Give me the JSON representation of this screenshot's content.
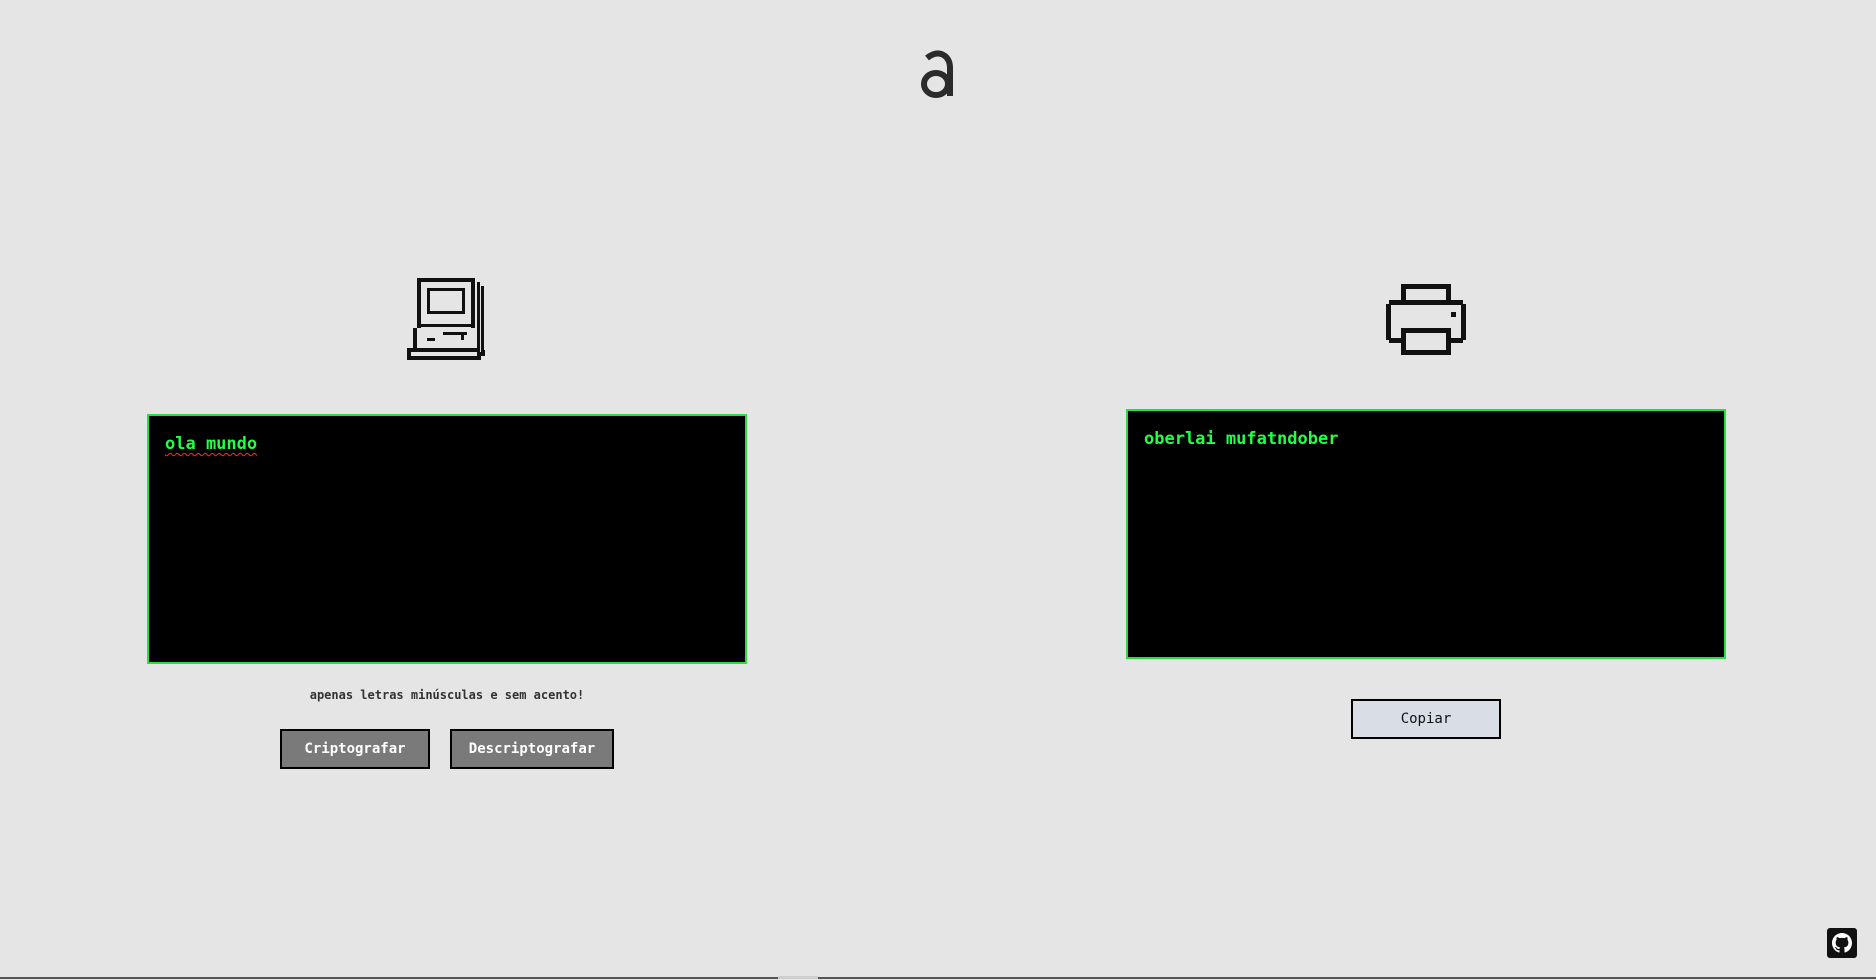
{
  "header": {
    "logo_icon": "alura-logo-icon"
  },
  "left_panel": {
    "icon": "computer-icon",
    "input_value": "ola mundo",
    "hint": "apenas letras minúsculas e sem acento!",
    "encrypt_label": "Criptografar",
    "decrypt_label": "Descriptografar"
  },
  "right_panel": {
    "icon": "printer-icon",
    "output_value": "oberlai mufatndober",
    "copy_label": "Copiar"
  },
  "footer": {
    "github_icon": "github-icon"
  },
  "colors": {
    "background": "#e5e5e5",
    "terminal_bg": "#000000",
    "terminal_text": "#22ff44",
    "terminal_border": "#27e03d",
    "button_dark": "#7a7a7a",
    "button_light": "#d8dde6"
  }
}
